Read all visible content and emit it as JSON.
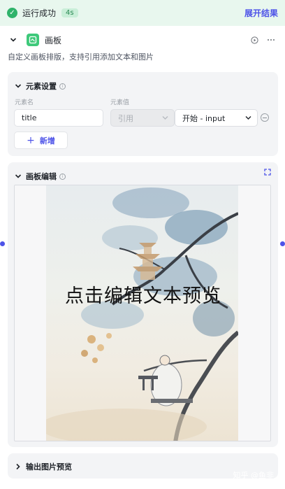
{
  "status": {
    "text": "运行成功",
    "time": "4s",
    "expand_label": "展开结果"
  },
  "node": {
    "title": "画板",
    "description": "自定义画板排版，支持引用添加文本和图片"
  },
  "elements": {
    "title": "元素设置",
    "name_col": "元素名",
    "value_col": "元素值",
    "name_value": "title",
    "ref_value": "引用",
    "source_value": "开始 - input",
    "add_label": "新增"
  },
  "canvas": {
    "title": "画板编辑",
    "overlay_text": "点击编辑文本预览"
  },
  "preview": {
    "title": "输出图片预览"
  },
  "watermark": "知乎 @鱼非",
  "colors": {
    "accent": "#4d53e8",
    "success": "#2fb36a",
    "status_bg": "#e8f7ee",
    "node_icon": "#3ec97a"
  }
}
